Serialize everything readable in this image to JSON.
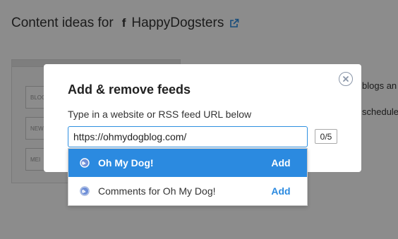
{
  "page": {
    "title_prefix": "Content ideas for",
    "brand_icon": "facebook-icon",
    "account_name": "HappyDogsters",
    "link_icon": "external-link-icon",
    "bg_fields": [
      "BLOG",
      "NEW",
      "MEI"
    ],
    "bg_texts": [
      "blogs an",
      "schedule"
    ]
  },
  "modal": {
    "title": "Add & remove feeds",
    "close_icon": "close-circle-icon",
    "label": "Type in a website or RSS feed URL below",
    "url_value": "https://ohmydogblog.com/",
    "counter": "0/5"
  },
  "suggestions": {
    "items": [
      {
        "name": "Oh My Dog!",
        "action": "Add",
        "icon": "globe-icon",
        "highlighted": true
      },
      {
        "name": "Comments for Oh My Dog!",
        "action": "Add",
        "icon": "globe-icon",
        "highlighted": false
      }
    ]
  },
  "colors": {
    "accent": "#2b8ae0",
    "overlay": "rgba(0,0,0,0.45)"
  }
}
